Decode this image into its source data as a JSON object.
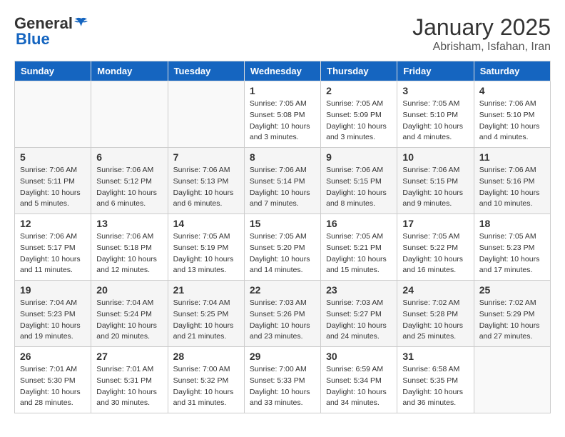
{
  "header": {
    "logo_general": "General",
    "logo_blue": "Blue",
    "title": "January 2025",
    "subtitle": "Abrisham, Isfahan, Iran"
  },
  "weekdays": [
    "Sunday",
    "Monday",
    "Tuesday",
    "Wednesday",
    "Thursday",
    "Friday",
    "Saturday"
  ],
  "weeks": [
    [
      {
        "day": "",
        "info": ""
      },
      {
        "day": "",
        "info": ""
      },
      {
        "day": "",
        "info": ""
      },
      {
        "day": "1",
        "info": "Sunrise: 7:05 AM\nSunset: 5:08 PM\nDaylight: 10 hours\nand 3 minutes."
      },
      {
        "day": "2",
        "info": "Sunrise: 7:05 AM\nSunset: 5:09 PM\nDaylight: 10 hours\nand 3 minutes."
      },
      {
        "day": "3",
        "info": "Sunrise: 7:05 AM\nSunset: 5:10 PM\nDaylight: 10 hours\nand 4 minutes."
      },
      {
        "day": "4",
        "info": "Sunrise: 7:06 AM\nSunset: 5:10 PM\nDaylight: 10 hours\nand 4 minutes."
      }
    ],
    [
      {
        "day": "5",
        "info": "Sunrise: 7:06 AM\nSunset: 5:11 PM\nDaylight: 10 hours\nand 5 minutes."
      },
      {
        "day": "6",
        "info": "Sunrise: 7:06 AM\nSunset: 5:12 PM\nDaylight: 10 hours\nand 6 minutes."
      },
      {
        "day": "7",
        "info": "Sunrise: 7:06 AM\nSunset: 5:13 PM\nDaylight: 10 hours\nand 6 minutes."
      },
      {
        "day": "8",
        "info": "Sunrise: 7:06 AM\nSunset: 5:14 PM\nDaylight: 10 hours\nand 7 minutes."
      },
      {
        "day": "9",
        "info": "Sunrise: 7:06 AM\nSunset: 5:15 PM\nDaylight: 10 hours\nand 8 minutes."
      },
      {
        "day": "10",
        "info": "Sunrise: 7:06 AM\nSunset: 5:15 PM\nDaylight: 10 hours\nand 9 minutes."
      },
      {
        "day": "11",
        "info": "Sunrise: 7:06 AM\nSunset: 5:16 PM\nDaylight: 10 hours\nand 10 minutes."
      }
    ],
    [
      {
        "day": "12",
        "info": "Sunrise: 7:06 AM\nSunset: 5:17 PM\nDaylight: 10 hours\nand 11 minutes."
      },
      {
        "day": "13",
        "info": "Sunrise: 7:06 AM\nSunset: 5:18 PM\nDaylight: 10 hours\nand 12 minutes."
      },
      {
        "day": "14",
        "info": "Sunrise: 7:05 AM\nSunset: 5:19 PM\nDaylight: 10 hours\nand 13 minutes."
      },
      {
        "day": "15",
        "info": "Sunrise: 7:05 AM\nSunset: 5:20 PM\nDaylight: 10 hours\nand 14 minutes."
      },
      {
        "day": "16",
        "info": "Sunrise: 7:05 AM\nSunset: 5:21 PM\nDaylight: 10 hours\nand 15 minutes."
      },
      {
        "day": "17",
        "info": "Sunrise: 7:05 AM\nSunset: 5:22 PM\nDaylight: 10 hours\nand 16 minutes."
      },
      {
        "day": "18",
        "info": "Sunrise: 7:05 AM\nSunset: 5:23 PM\nDaylight: 10 hours\nand 17 minutes."
      }
    ],
    [
      {
        "day": "19",
        "info": "Sunrise: 7:04 AM\nSunset: 5:23 PM\nDaylight: 10 hours\nand 19 minutes."
      },
      {
        "day": "20",
        "info": "Sunrise: 7:04 AM\nSunset: 5:24 PM\nDaylight: 10 hours\nand 20 minutes."
      },
      {
        "day": "21",
        "info": "Sunrise: 7:04 AM\nSunset: 5:25 PM\nDaylight: 10 hours\nand 21 minutes."
      },
      {
        "day": "22",
        "info": "Sunrise: 7:03 AM\nSunset: 5:26 PM\nDaylight: 10 hours\nand 23 minutes."
      },
      {
        "day": "23",
        "info": "Sunrise: 7:03 AM\nSunset: 5:27 PM\nDaylight: 10 hours\nand 24 minutes."
      },
      {
        "day": "24",
        "info": "Sunrise: 7:02 AM\nSunset: 5:28 PM\nDaylight: 10 hours\nand 25 minutes."
      },
      {
        "day": "25",
        "info": "Sunrise: 7:02 AM\nSunset: 5:29 PM\nDaylight: 10 hours\nand 27 minutes."
      }
    ],
    [
      {
        "day": "26",
        "info": "Sunrise: 7:01 AM\nSunset: 5:30 PM\nDaylight: 10 hours\nand 28 minutes."
      },
      {
        "day": "27",
        "info": "Sunrise: 7:01 AM\nSunset: 5:31 PM\nDaylight: 10 hours\nand 30 minutes."
      },
      {
        "day": "28",
        "info": "Sunrise: 7:00 AM\nSunset: 5:32 PM\nDaylight: 10 hours\nand 31 minutes."
      },
      {
        "day": "29",
        "info": "Sunrise: 7:00 AM\nSunset: 5:33 PM\nDaylight: 10 hours\nand 33 minutes."
      },
      {
        "day": "30",
        "info": "Sunrise: 6:59 AM\nSunset: 5:34 PM\nDaylight: 10 hours\nand 34 minutes."
      },
      {
        "day": "31",
        "info": "Sunrise: 6:58 AM\nSunset: 5:35 PM\nDaylight: 10 hours\nand 36 minutes."
      },
      {
        "day": "",
        "info": ""
      }
    ]
  ]
}
